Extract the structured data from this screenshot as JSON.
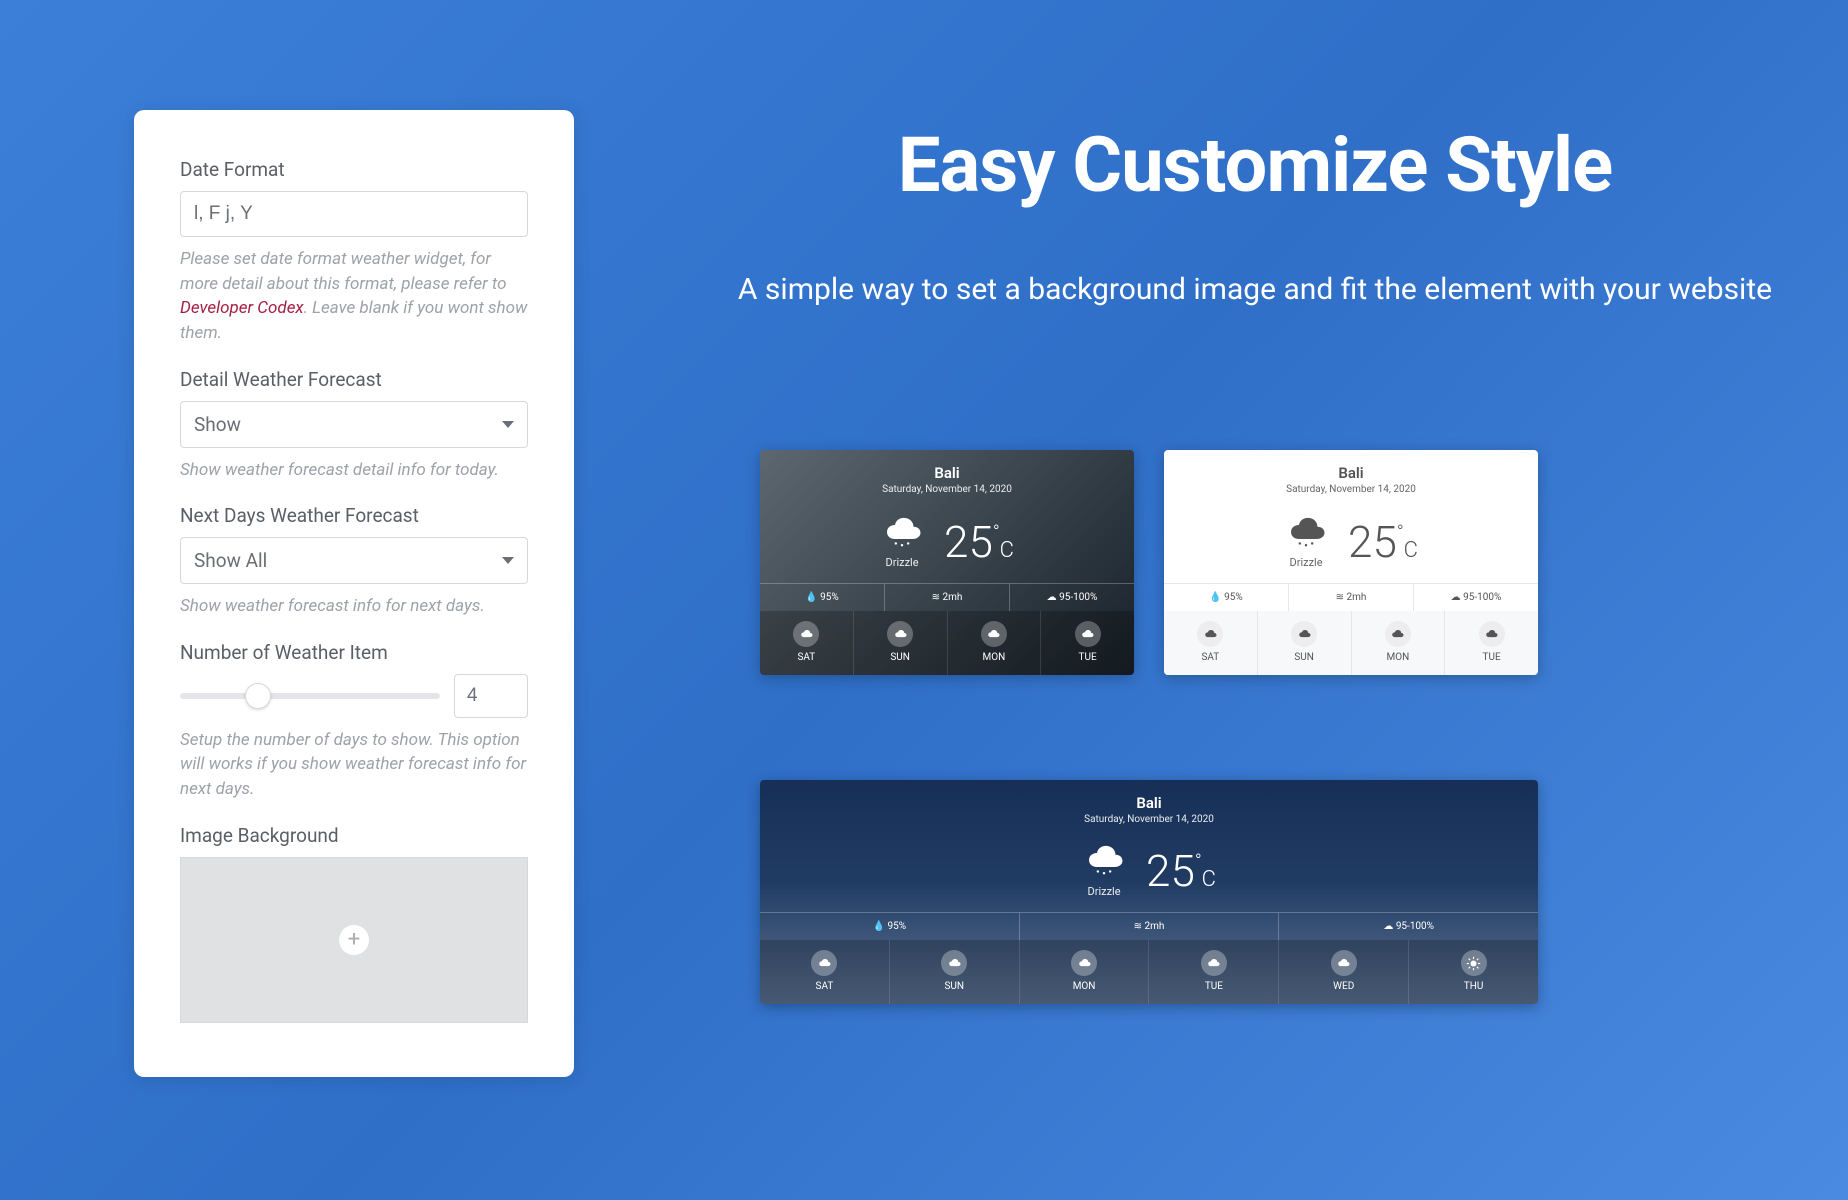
{
  "headline": {
    "title": "Easy Customize Style",
    "subtitle": "A simple way to set a background image and fit the element with your website"
  },
  "panel": {
    "date_format": {
      "label": "Date Format",
      "value": "l, F j, Y"
    },
    "date_help_prefix": "Please set date format weather widget, for more detail about this format, please refer to ",
    "date_help_link": "Developer Codex",
    "date_help_suffix": ". Leave blank if you wont show them.",
    "detail_forecast": {
      "label": "Detail Weather Forecast",
      "value": "Show",
      "help": "Show weather forecast detail info for today."
    },
    "next_days": {
      "label": "Next Days Weather Forecast",
      "value": "Show All",
      "help": "Show weather forecast info for next days."
    },
    "item_count": {
      "label": "Number of Weather Item",
      "value": "4",
      "help": "Setup the number of days to show. This option will works if you show weather forecast info for next days."
    },
    "image_bg": {
      "label": "Image Background"
    }
  },
  "weather": {
    "city": "Bali",
    "date": "Saturday, November 14, 2020",
    "condition": "Drizzle",
    "temp": "25",
    "unit": "C",
    "stats": {
      "humidity": "95%",
      "wind": "2mh",
      "clouds": "95-100%"
    },
    "days4": [
      "SAT",
      "SUN",
      "MON",
      "TUE"
    ],
    "days6": [
      "SAT",
      "SUN",
      "MON",
      "TUE",
      "WED",
      "THU"
    ]
  }
}
